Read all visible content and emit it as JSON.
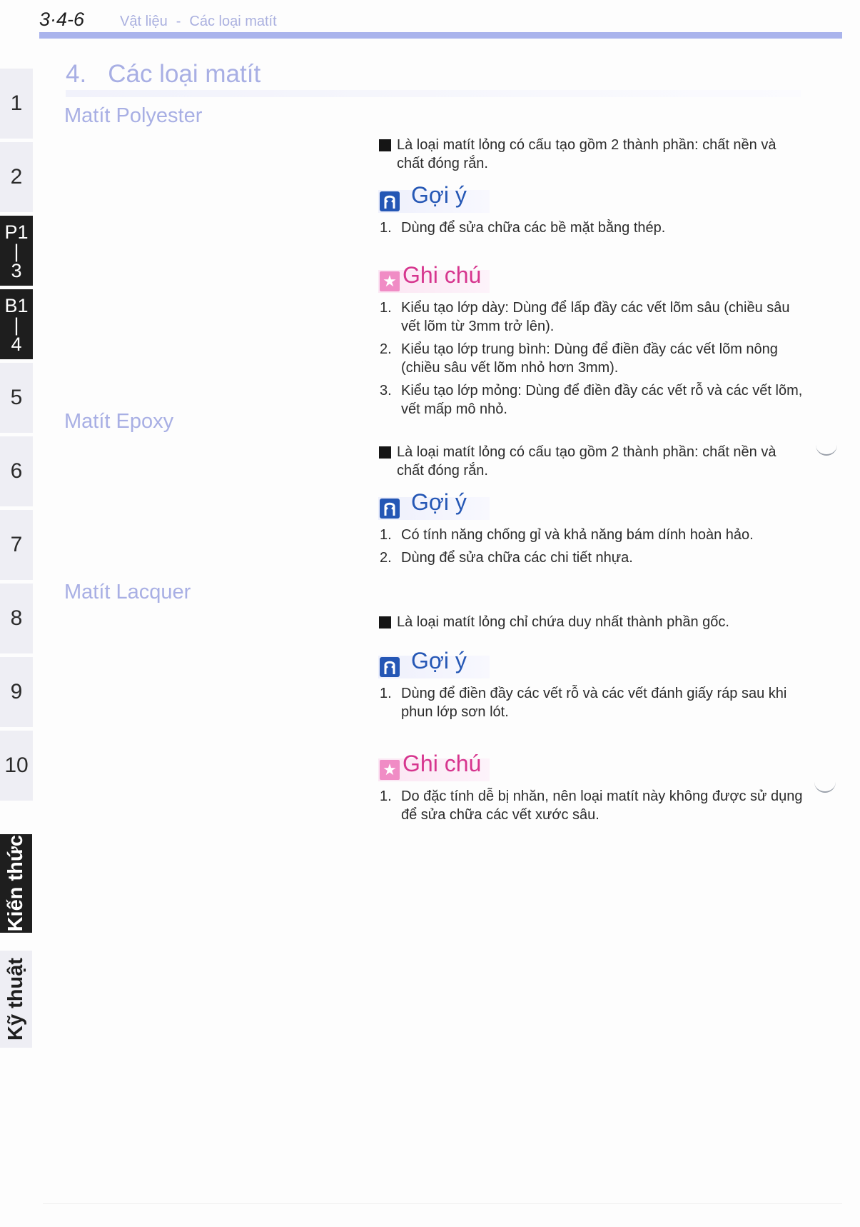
{
  "header": {
    "page_number": "3·4-6",
    "breadcrumb": [
      "Vật liệu",
      "Các loại matít"
    ],
    "separator": "-"
  },
  "side_tabs": [
    {
      "label": "1",
      "active": false
    },
    {
      "label": "2",
      "active": false
    },
    {
      "lines": [
        "P1",
        "|",
        "3"
      ],
      "active": true
    },
    {
      "lines": [
        "B1",
        "|",
        "4"
      ],
      "active": true
    },
    {
      "label": "5",
      "active": false
    },
    {
      "label": "6",
      "active": false
    },
    {
      "label": "7",
      "active": false
    },
    {
      "label": "8",
      "active": false
    },
    {
      "label": "9",
      "active": false
    },
    {
      "label": "10",
      "active": false
    }
  ],
  "vertical_tabs": [
    {
      "label": "Kiến thức",
      "active": true
    },
    {
      "label": "Kỹ thuật",
      "active": false
    }
  ],
  "section": {
    "number": "4.",
    "title": "Các loại matít"
  },
  "products": [
    {
      "name": "Matít Polyester",
      "description": "Là loại matít lỏng có cấu tạo gồm 2 thành phần: chất nền và chất đóng rắn.",
      "hint_label": "Gợi ý",
      "hints": [
        {
          "n": "1.",
          "text": "Dùng để sửa chữa các bề mặt bằng thép."
        }
      ],
      "note_label": "Ghi chú",
      "notes": [
        {
          "n": "1.",
          "text": "Kiểu tạo lớp dày: Dùng để lấp đầy các vết lõm sâu (chiều sâu vết lõm từ 3mm trở lên)."
        },
        {
          "n": "2.",
          "text": "Kiểu tạo lớp trung bình: Dùng để điền đầy các vết lõm nông (chiều sâu vết lõm nhỏ hơn 3mm)."
        },
        {
          "n": "3.",
          "text": "Kiểu tạo lớp mỏng: Dùng để điền đầy các vết rỗ và các vết lõm, vết mấp mô nhỏ."
        }
      ]
    },
    {
      "name": "Matít Epoxy",
      "description": "Là loại matít lỏng có cấu tạo gồm 2 thành phần: chất nền và chất đóng rắn.",
      "hint_label": "Gợi ý",
      "hints": [
        {
          "n": "1.",
          "text": "Có tính năng chống gỉ và khả năng bám dính hoàn hảo."
        },
        {
          "n": "2.",
          "text": "Dùng để sửa chữa các chi tiết nhựa."
        }
      ]
    },
    {
      "name": "Matít Lacquer",
      "description": "Là loại matít lỏng chỉ chứa duy nhất thành phần gốc.",
      "hint_label": "Gợi ý",
      "hints": [
        {
          "n": "1.",
          "text": "Dùng để điền đầy các vết rỗ và các vết đánh giấy ráp sau khi phun lớp sơn lót."
        }
      ],
      "note_label": "Ghi chú",
      "notes": [
        {
          "n": "1.",
          "text": "Do đặc tính dễ bị nhăn, nên loại matít này không được sử dụng để sửa chữa các vết xước sâu."
        }
      ]
    }
  ],
  "colors": {
    "accent_blue": "#2557b5",
    "note_pink": "#d6358e",
    "heading_lavender": "#a8afe4",
    "rule_blue": "#aab4ec"
  }
}
